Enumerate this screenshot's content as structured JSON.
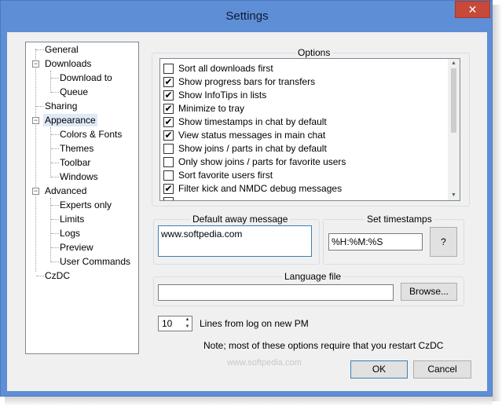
{
  "window": {
    "title": "Settings",
    "close_glyph": "✕"
  },
  "tree": {
    "items": [
      {
        "label": "General"
      },
      {
        "label": "Downloads",
        "expander": "−"
      },
      {
        "label": "Download to"
      },
      {
        "label": "Queue"
      },
      {
        "label": "Sharing"
      },
      {
        "label": "Appearance",
        "expander": "−"
      },
      {
        "label": "Colors & Fonts"
      },
      {
        "label": "Themes"
      },
      {
        "label": "Toolbar"
      },
      {
        "label": "Windows"
      },
      {
        "label": "Advanced",
        "expander": "−"
      },
      {
        "label": "Experts only"
      },
      {
        "label": "Limits"
      },
      {
        "label": "Logs"
      },
      {
        "label": "Preview"
      },
      {
        "label": "User Commands"
      },
      {
        "label": "CzDC"
      }
    ],
    "selected": "Appearance"
  },
  "options": {
    "group_label": "Options",
    "items": [
      {
        "label": "Sort all downloads first",
        "checked": false
      },
      {
        "label": "Show progress bars for transfers",
        "checked": true
      },
      {
        "label": "Show InfoTips in lists",
        "checked": true
      },
      {
        "label": "Minimize to tray",
        "checked": true
      },
      {
        "label": "Show timestamps in chat by default",
        "checked": true
      },
      {
        "label": "View status messages in main chat",
        "checked": true
      },
      {
        "label": "Show joins / parts in chat by default",
        "checked": false
      },
      {
        "label": "Only show joins / parts for favorite users",
        "checked": false
      },
      {
        "label": "Sort favorite users first",
        "checked": false
      },
      {
        "label": "Filter kick and NMDC debug messages",
        "checked": true
      }
    ],
    "check_glyph": "✔"
  },
  "away": {
    "group_label": "Default away message",
    "value": "www.softpedia.com"
  },
  "timestamps": {
    "group_label": "Set timestamps",
    "value": "%H:%M:%S",
    "help_label": "?"
  },
  "language": {
    "group_label": "Language file",
    "value": "",
    "browse_label": "Browse..."
  },
  "pm_log": {
    "value": "10",
    "label": "Lines from log on new PM"
  },
  "note": "Note; most of these options require that you restart CzDC",
  "footer": {
    "ok_label": "OK",
    "cancel_label": "Cancel"
  },
  "watermark": "www.softpedia.com",
  "colors": {
    "frame": "#5e8fd6",
    "close": "#c7493a",
    "selection": "#dfe9f7"
  }
}
